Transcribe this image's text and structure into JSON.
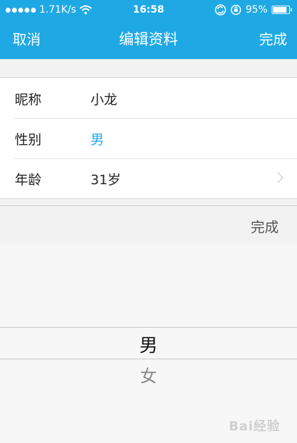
{
  "status_bar": {
    "signal_dots": 5,
    "network_speed": "1.71K/s",
    "time": "16:58",
    "battery_percent": "95%",
    "battery_level": 0.95,
    "icons": [
      "signal-dots-icon",
      "wifi-icon",
      "sync-icon",
      "orientation-lock-icon",
      "battery-icon"
    ]
  },
  "nav": {
    "cancel_label": "取消",
    "title": "编辑资料",
    "done_label": "完成"
  },
  "form": {
    "rows": [
      {
        "label": "昵称",
        "value": "小龙"
      },
      {
        "label": "性别",
        "value": "男"
      },
      {
        "label": "年龄",
        "value": "31岁"
      }
    ]
  },
  "picker": {
    "done_label": "完成",
    "selected_option": "男",
    "next_option": "女"
  },
  "watermark": {
    "text": "Bai经验"
  },
  "colors": {
    "accent": "#1fa9e4",
    "background": "#f2f2f2"
  }
}
